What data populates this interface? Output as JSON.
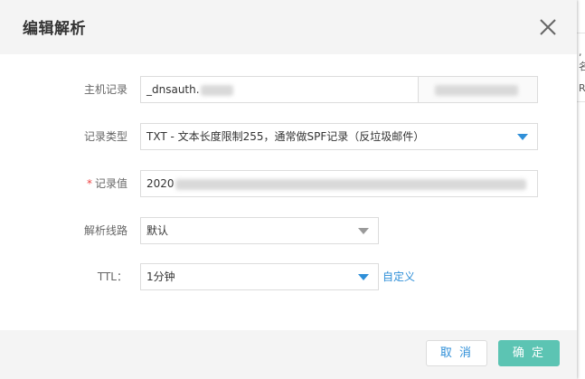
{
  "dialog": {
    "title": "编辑解析",
    "close_icon": "close-icon"
  },
  "form": {
    "host_record": {
      "label": "主机记录",
      "value": "_dnsauth."
    },
    "record_type": {
      "label": "记录类型",
      "value": "TXT - 文本长度限制255，通常做SPF记录（反垃圾邮件）"
    },
    "record_value": {
      "label": "记录值",
      "required_mark": "*",
      "value": "2020"
    },
    "line": {
      "label": "解析线路",
      "value": "默认"
    },
    "ttl": {
      "label": "TTL：",
      "value": "1分钟",
      "custom_link": "自定义"
    }
  },
  "footer": {
    "cancel_label": "取 消",
    "ok_label": "确 定"
  },
  "colors": {
    "accent_blue": "#2f8fd8",
    "confirm_green": "#5cc4b3",
    "required_red": "#e44444"
  }
}
